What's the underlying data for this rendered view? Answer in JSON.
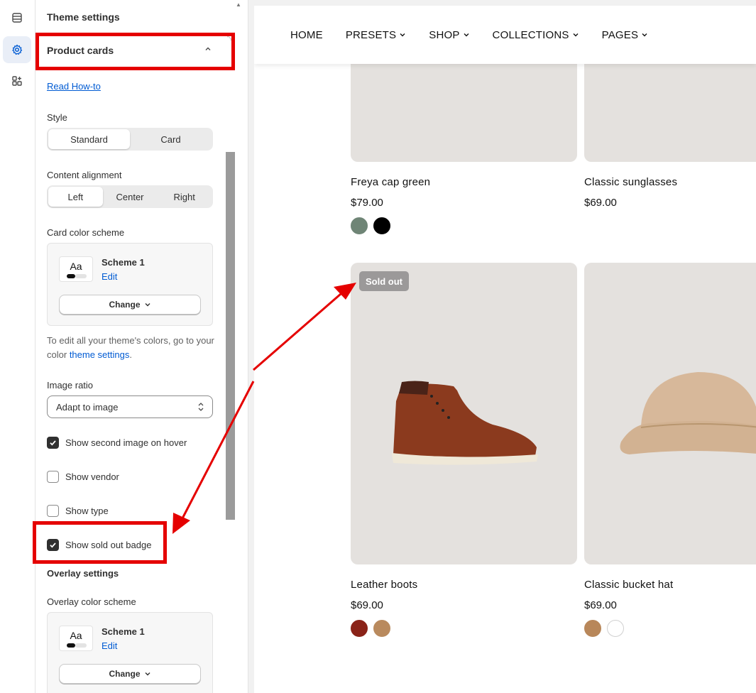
{
  "panel": {
    "header": "Theme settings",
    "section_title": "Product cards",
    "read_howto": "Read How-to",
    "style_label": "Style",
    "style_options": [
      "Standard",
      "Card"
    ],
    "content_alignment_label": "Content alignment",
    "alignment_options": [
      "Left",
      "Center",
      "Right"
    ],
    "card_color_label": "Card color scheme",
    "card_scheme": {
      "aa": "Aa",
      "name": "Scheme 1",
      "edit": "Edit",
      "change": "Change"
    },
    "colors_note": "To edit all your theme's colors, go to your color",
    "colors_note_link": "theme settings",
    "colors_note_end": ".",
    "image_ratio_label": "Image ratio",
    "image_ratio_value": "Adapt to image",
    "checkboxes": [
      {
        "label": "Show second image on hover",
        "checked": true
      },
      {
        "label": "Show vendor",
        "checked": false
      },
      {
        "label": "Show type",
        "checked": false
      },
      {
        "label": "Show sold out badge",
        "checked": true
      }
    ],
    "overlay_title": "Overlay settings",
    "overlay_color_label": "Overlay color scheme",
    "overlay_scheme": {
      "aa": "Aa",
      "name": "Scheme 1",
      "edit": "Edit",
      "change": "Change"
    }
  },
  "store": {
    "nav": [
      "HOME",
      "PRESETS",
      "SHOP",
      "COLLECTIONS",
      "PAGES"
    ],
    "products": [
      {
        "name": "Freya cap green",
        "price": "$79.00",
        "swatches": [
          "#6f8576",
          "#000000"
        ]
      },
      {
        "name": "Classic sunglasses",
        "price": "$69.00",
        "swatches": []
      },
      {
        "name": "Leather boots",
        "price": "$69.00",
        "badge": "Sold out",
        "swatches": [
          "#8a2318",
          "#b98a5e"
        ]
      },
      {
        "name": "Classic bucket hat",
        "price": "$69.00",
        "swatches": [
          "#b8875a",
          "#ffffff"
        ]
      }
    ]
  },
  "colors": {
    "annotation_red": "#e50000",
    "card_bg": "#e4e1de",
    "link_blue": "#005bd3"
  }
}
